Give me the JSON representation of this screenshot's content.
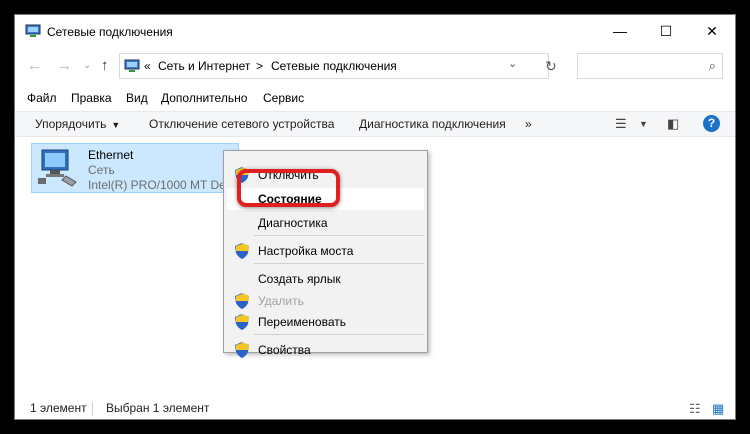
{
  "window": {
    "title": "Сетевые подключения",
    "minimize_glyph": "—",
    "maximize_glyph": "☐",
    "close_glyph": "✕"
  },
  "nav": {
    "back_glyph": "←",
    "forward_glyph": "→",
    "up_glyph": "↑",
    "chevrons": "«",
    "crumbs": [
      "Сеть и Интернет",
      "Сетевые подключения"
    ],
    "crumb_sep": ">",
    "dropdown_glyph": "⌄",
    "refresh_glyph": "↻",
    "search_placeholder": "",
    "search_glyph": "⌕"
  },
  "menubar": [
    "Файл",
    "Правка",
    "Вид",
    "Дополнительно",
    "Сервис"
  ],
  "commandbar": {
    "organize": "Упорядочить",
    "disable_device": "Отключение сетевого устройства",
    "diagnose": "Диагностика подключения",
    "more": "»",
    "help": "?"
  },
  "item": {
    "name": "Ethernet",
    "network": "Сеть",
    "adapter": "Intel(R) PRO/1000 MT Desktop Adapter"
  },
  "context_menu": [
    {
      "label": "Отключить",
      "shield": true,
      "bold": false,
      "disabled": false
    },
    {
      "label": "Состояние",
      "shield": false,
      "bold": true,
      "disabled": false,
      "highlighted": true
    },
    {
      "label": "Диагностика",
      "shield": false,
      "bold": false,
      "disabled": false
    },
    {
      "label": "Настройка моста",
      "shield": true,
      "bold": false,
      "disabled": false
    },
    {
      "label": "Создать ярлык",
      "shield": false,
      "bold": false,
      "disabled": false
    },
    {
      "label": "Удалить",
      "shield": true,
      "bold": false,
      "disabled": true
    },
    {
      "label": "Переименовать",
      "shield": true,
      "bold": false,
      "disabled": false
    },
    {
      "label": "Свойства",
      "shield": true,
      "bold": false,
      "disabled": false
    }
  ],
  "status": {
    "count": "1 элемент",
    "selected": "Выбран 1 элемент"
  },
  "colors": {
    "selection": "#cce8ff",
    "callout": "#e02020",
    "help": "#1a73c8"
  }
}
